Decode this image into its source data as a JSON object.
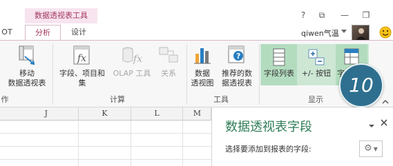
{
  "context_tab_title": "数据透视表工具",
  "tabs": {
    "prev_fragment": "OT",
    "analyze": "分析",
    "design": "设计"
  },
  "window": {
    "help": "?",
    "ribbon_display": "⧉",
    "minimize": "—",
    "restore": "❐",
    "user_name": "qiwen气温"
  },
  "ribbon": {
    "move": {
      "line1": "移动",
      "line2": "数据透视表"
    },
    "fields": {
      "line1": "字段、项目和",
      "line2": "集"
    },
    "olap": {
      "label": "OLAP 工具"
    },
    "relations": {
      "label": "关系"
    },
    "pivot_chart": {
      "line1": "数据",
      "line2": "透视图"
    },
    "recommended": {
      "line1": "推荐的数",
      "line2": "据透视表"
    },
    "field_list": {
      "label": "字段列表"
    },
    "plus_minus": {
      "label": "+/- 按钮"
    },
    "field_headers": {
      "label": "字"
    },
    "groups": {
      "actions_fragment": "作",
      "calculate": "计算",
      "tools": "工具",
      "show": "显示"
    }
  },
  "step_badge": "10",
  "columns": [
    "J",
    "K",
    "L",
    "M"
  ],
  "pane": {
    "title": "数据透视表字段",
    "subtitle": "选择要添加到报表的字段:"
  },
  "colors": {
    "context_accent": "#a4395f",
    "context_band": "#f7e4ee",
    "pane_title": "#2f7d57",
    "show_highlight": "#cde7d4",
    "badge": "#2e6f8f"
  }
}
